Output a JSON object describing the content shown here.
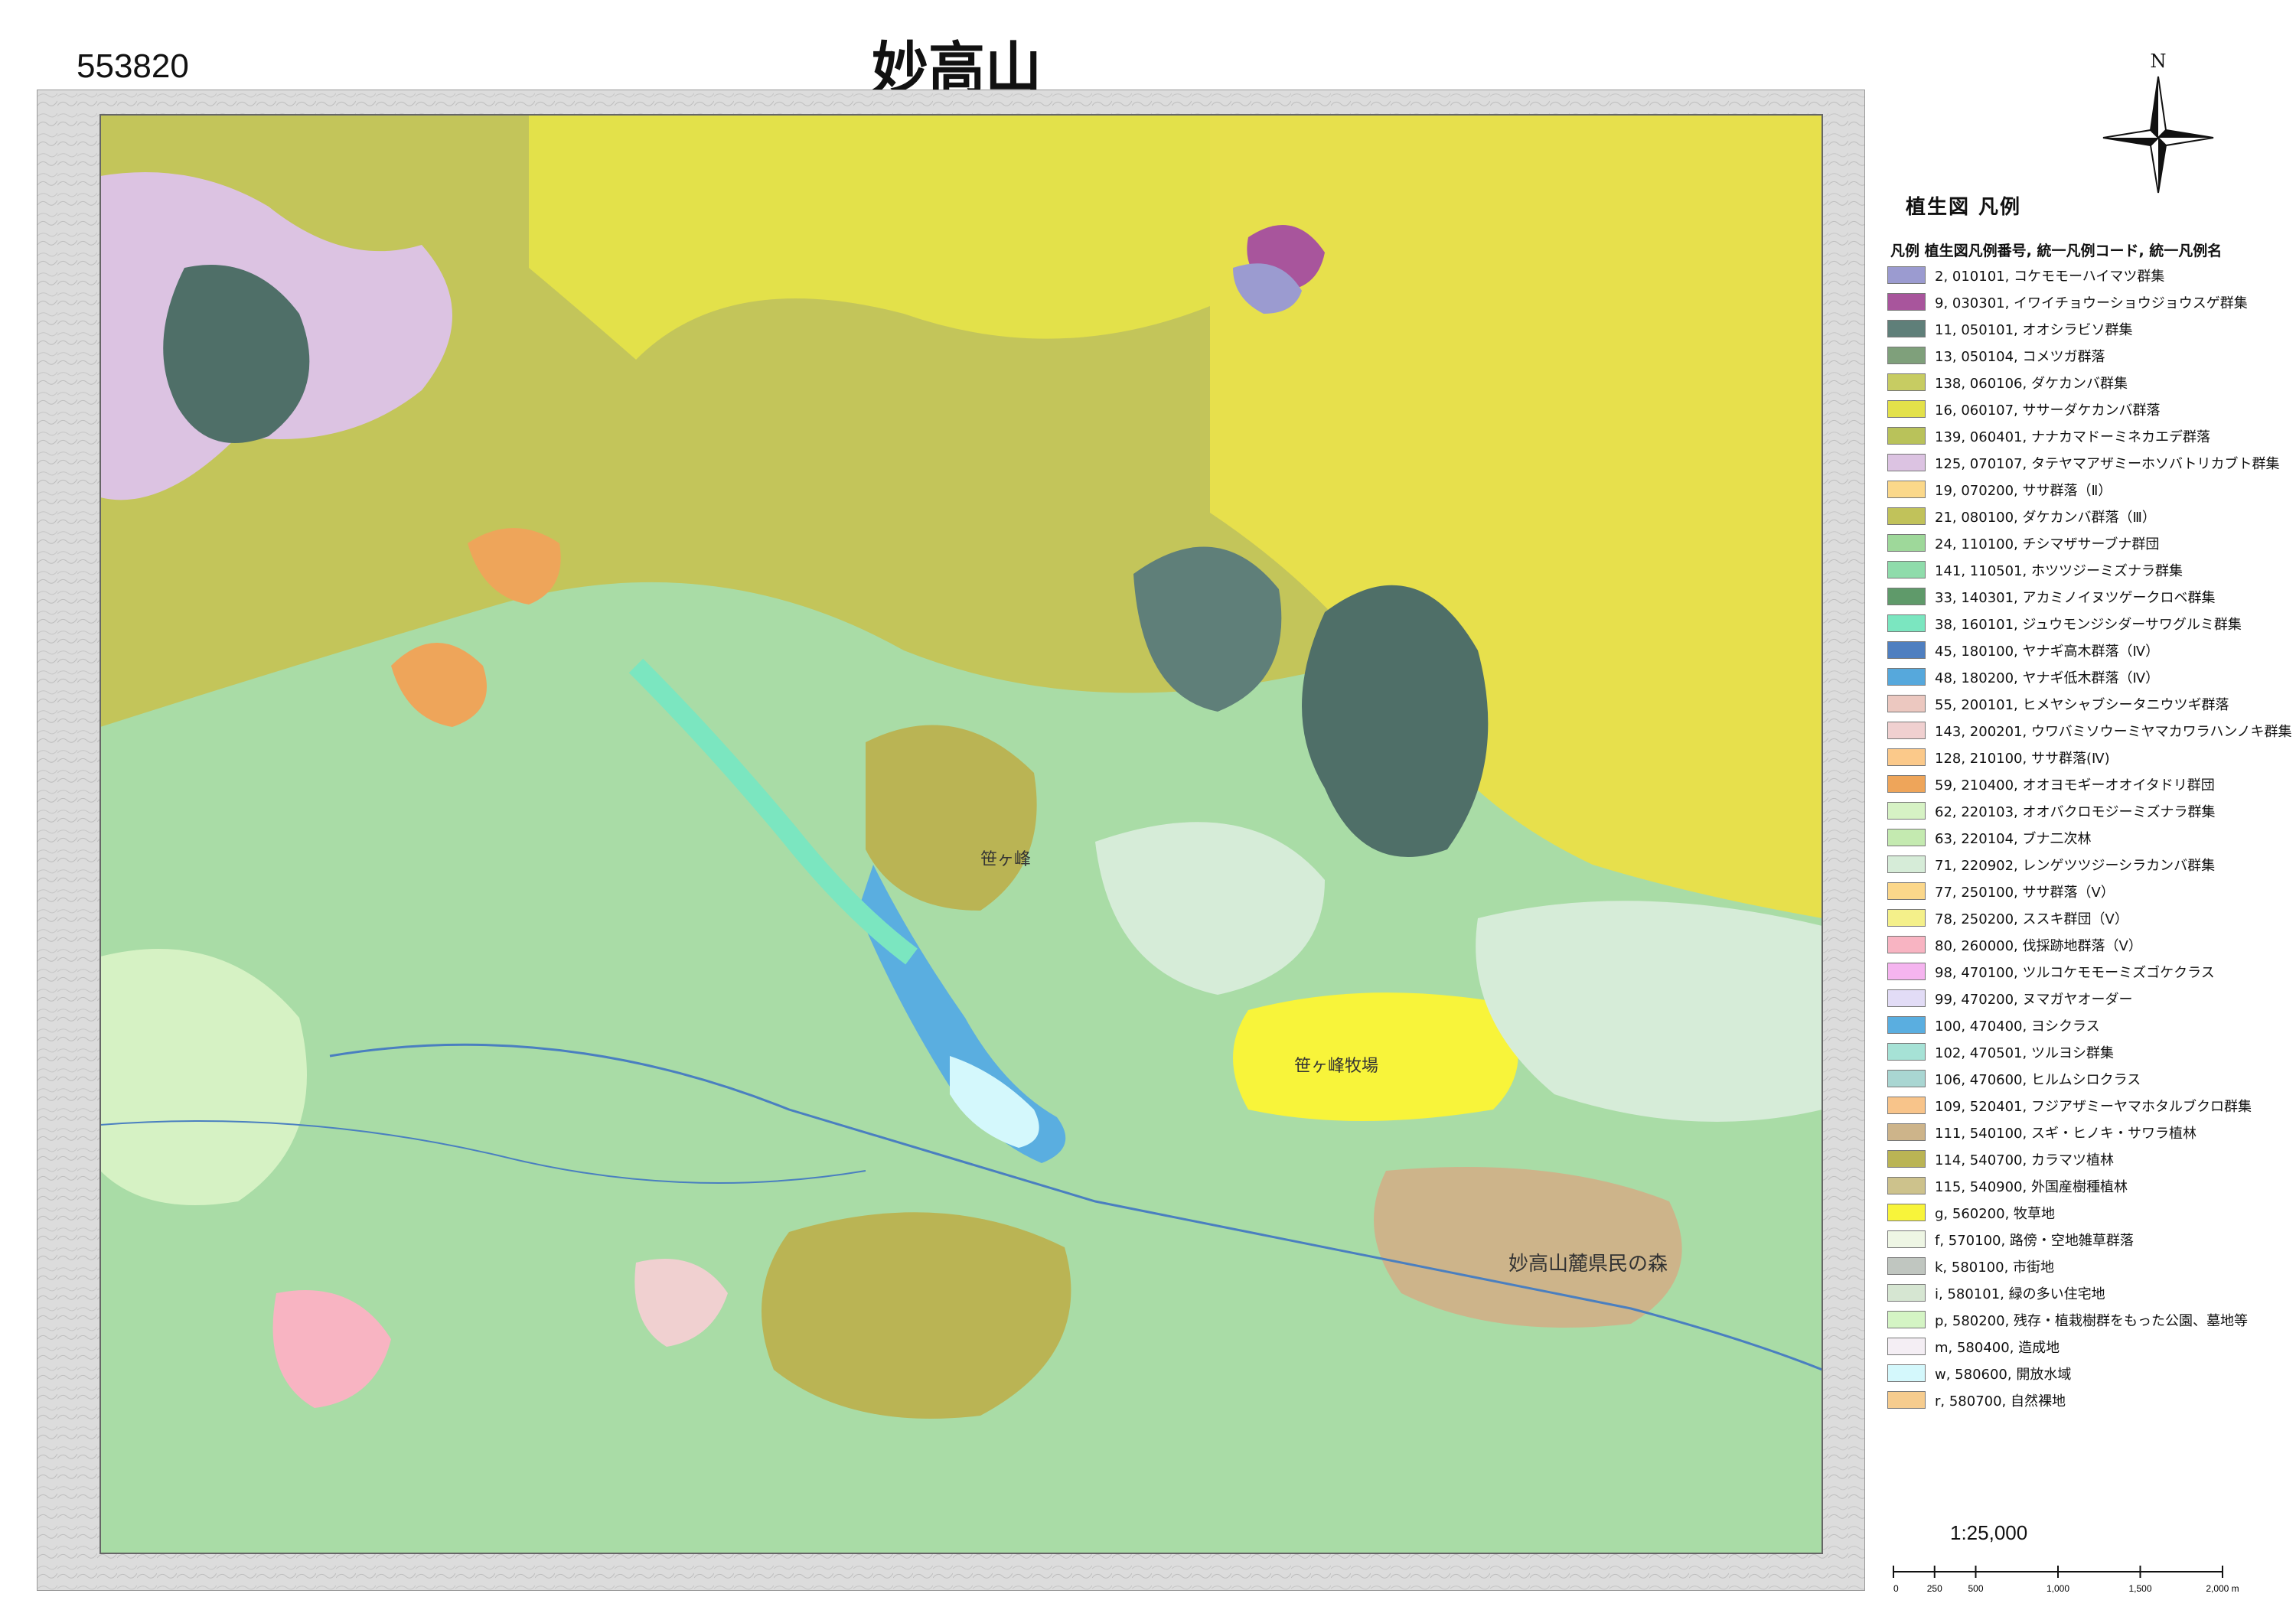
{
  "sheet_id": "553820",
  "title": "妙高山",
  "north_label": "N",
  "legend": {
    "title": "植生図 凡例",
    "header": "凡例 植生図凡例番号, 統一凡例コード, 統一凡例名",
    "items": [
      {
        "label": "2, 010101, コケモモーハイマツ群集",
        "color": "#9b9bd0"
      },
      {
        "label": "9, 030301, イワイチョウーショウジョウスゲ群集",
        "color": "#a8559c"
      },
      {
        "label": "11, 050101, オオシラビソ群集",
        "color": "#5f7f79"
      },
      {
        "label": "13, 050104, コメツガ群落",
        "color": "#7fa07b"
      },
      {
        "label": "138, 060106, ダケカンバ群集",
        "color": "#c7cc62"
      },
      {
        "label": "16, 060107, ササーダケカンバ群落",
        "color": "#e3e14a"
      },
      {
        "label": "139, 060401, ナナカマドーミネカエデ群落",
        "color": "#b9c25a"
      },
      {
        "label": "125, 070107, タテヤマアザミーホソバトリカブト群集",
        "color": "#dcc3e2"
      },
      {
        "label": "19, 070200, ササ群落（Ⅱ）",
        "color": "#fbd88a"
      },
      {
        "label": "21, 080100, ダケカンバ群落（Ⅲ）",
        "color": "#c1c25a"
      },
      {
        "label": "24, 110100, チシマザサーブナ群団",
        "color": "#9ed89a"
      },
      {
        "label": "141, 110501, ホツツジーミズナラ群集",
        "color": "#8fdcab"
      },
      {
        "label": "33, 140301, アカミノイヌツゲークロベ群集",
        "color": "#5f9a6a"
      },
      {
        "label": "38, 160101, ジュウモンジシダーサワグルミ群集",
        "color": "#7be6c0"
      },
      {
        "label": "45, 180100, ヤナギ高木群落（Ⅳ）",
        "color": "#4f7fc0"
      },
      {
        "label": "48, 180200, ヤナギ低木群落（Ⅳ）",
        "color": "#56a8dc"
      },
      {
        "label": "55, 200101, ヒメヤシャブシータニウツギ群落",
        "color": "#ecc8c0"
      },
      {
        "label": "143, 200201, ウワバミソウーミヤマカワラハンノキ群集",
        "color": "#f0d0d0"
      },
      {
        "label": "128, 210100, ササ群落(Ⅳ)",
        "color": "#fbc98a"
      },
      {
        "label": "59, 210400, オオヨモギーオオイタドリ群団",
        "color": "#eea55a"
      },
      {
        "label": "62, 220103, オオバクロモジーミズナラ群集",
        "color": "#d6f2c4"
      },
      {
        "label": "63, 220104, ブナ二次林",
        "color": "#c4eab0"
      },
      {
        "label": "71, 220902, レンゲツツジーシラカンバ群集",
        "color": "#d6ecd8"
      },
      {
        "label": "77, 250100, ササ群落（Ⅴ）",
        "color": "#fbd78a"
      },
      {
        "label": "78, 250200, ススキ群団（Ⅴ）",
        "color": "#f4f08a"
      },
      {
        "label": "80, 260000, 伐採跡地群落（Ⅴ）",
        "color": "#f8b4c2"
      },
      {
        "label": "98, 470100, ツルコケモモーミズゴケクラス",
        "color": "#f5b4ef"
      },
      {
        "label": "99, 470200, ヌマガヤオーダー",
        "color": "#e2dcf6"
      },
      {
        "label": "100, 470400, ヨシクラス",
        "color": "#5aaee0"
      },
      {
        "label": "102, 470501, ツルヨシ群集",
        "color": "#a6e2d6"
      },
      {
        "label": "106, 470600, ヒルムシロクラス",
        "color": "#a9d6d2"
      },
      {
        "label": "109, 520401, フジアザミーヤマホタルブクロ群集",
        "color": "#f8c48a"
      },
      {
        "label": "111, 540100, スギ・ヒノキ・サワラ植林",
        "color": "#cdb48a"
      },
      {
        "label": "114, 540700, カラマツ植林",
        "color": "#bab454"
      },
      {
        "label": "115, 540900, 外国産樹種植林",
        "color": "#cdc28c"
      },
      {
        "label": "g, 560200, 牧草地",
        "color": "#f8f43a"
      },
      {
        "label": "f, 570100, 路傍・空地雑草群落",
        "color": "#eef6e4"
      },
      {
        "label": "k, 580100, 市街地",
        "color": "#c0c6c0"
      },
      {
        "label": "i, 580101, 緑の多い住宅地",
        "color": "#d6e6d2"
      },
      {
        "label": "p, 580200, 残存・植栽樹群をもった公園、墓地等",
        "color": "#d4f4c4"
      },
      {
        "label": "m, 580400, 造成地",
        "color": "#f4eef4"
      },
      {
        "label": "w, 580600, 開放水域",
        "color": "#d4f8fc"
      },
      {
        "label": "r, 580700, 自然裸地",
        "color": "#f6cc8e"
      }
    ]
  },
  "scale": {
    "ratio": "1:25,000",
    "ticks": [
      "0",
      "250",
      "500",
      "1,000",
      "1,500",
      "2,000 m"
    ],
    "tick_values_m": [
      0,
      250,
      500,
      1000,
      1500,
      2000
    ]
  },
  "map": {
    "place_labels": [
      "妙高山麓県民の森",
      "笹ヶ峰牧場",
      "笹ヶ峰"
    ]
  }
}
